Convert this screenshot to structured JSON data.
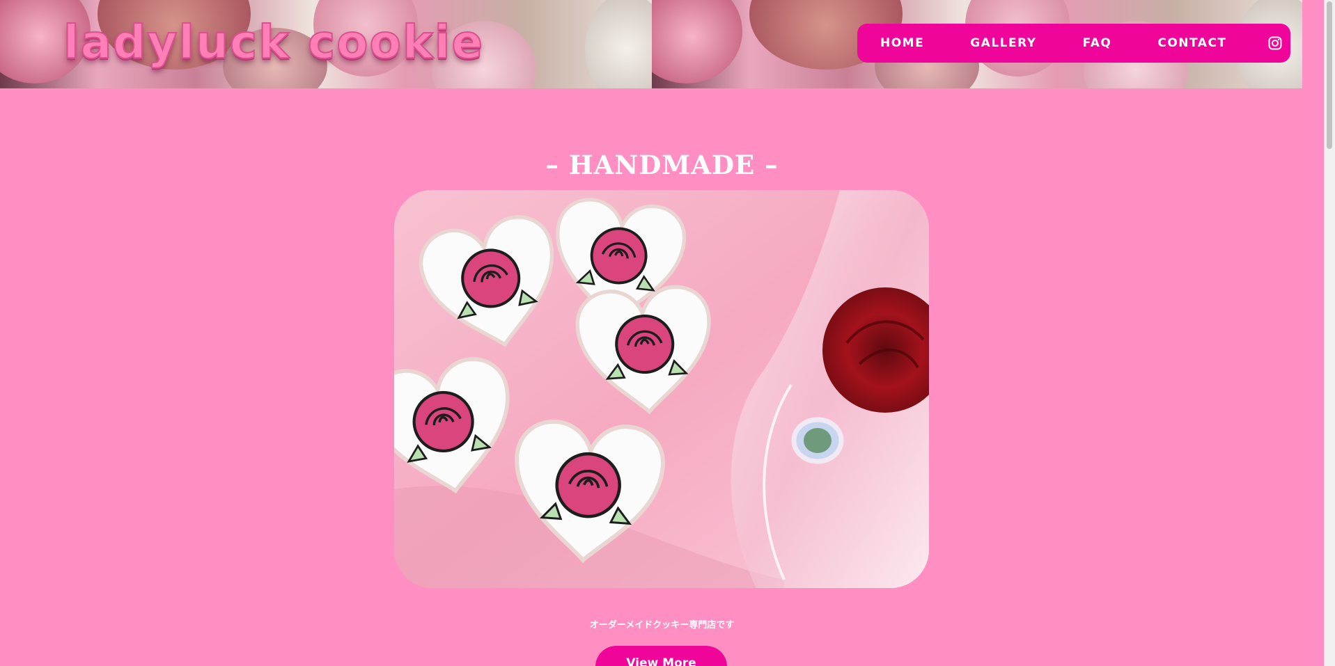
{
  "site": {
    "logo_text": "ladyluck cookie"
  },
  "nav": {
    "items": [
      {
        "label": "HOME"
      },
      {
        "label": "GALLERY"
      },
      {
        "label": "FAQ"
      },
      {
        "label": "CONTACT"
      }
    ],
    "social_icon": "instagram-icon"
  },
  "main": {
    "section_title": "– HANDMADE –",
    "tagline": "オーダーメイドクッキー専門店です",
    "cta_label": "View More"
  },
  "colors": {
    "page_background": "#ff8fc3",
    "accent": "#f0059a",
    "text_light": "#ffffff"
  }
}
